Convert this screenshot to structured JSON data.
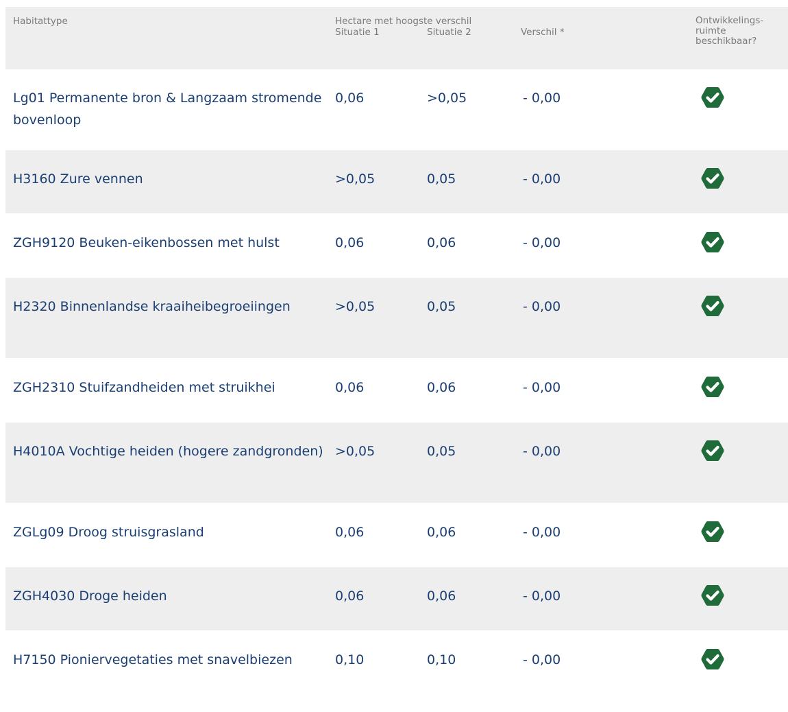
{
  "header": {
    "habitat": "Habitattype",
    "hectare": "Hectare met hoogste verschil",
    "situatie1": "Situatie 1",
    "situatie2": "Situatie 2",
    "verschil": "Verschil *",
    "ruimte": "Ontwikkelings-ruimte beschikbaar?"
  },
  "colors": {
    "header_bg": "#eeeeee",
    "header_text": "#7a7a7a",
    "row_text": "#1b3f73",
    "check_green": "#1f6b3a"
  },
  "check_icon": "check-hexagon-icon",
  "rows": [
    {
      "name": "Lg01 Permanente bron & Langzaam stromende bovenloop",
      "s1": "0,06",
      "s2": ">0,05",
      "diff": "- 0,00",
      "available": true
    },
    {
      "name": "H3160 Zure vennen",
      "s1": ">0,05",
      "s2": "0,05",
      "diff": "- 0,00",
      "available": true
    },
    {
      "name": "ZGH9120 Beuken-eikenbossen met hulst",
      "s1": "0,06",
      "s2": "0,06",
      "diff": "- 0,00",
      "available": true
    },
    {
      "name": "H2320 Binnenlandse kraaiheibegroeiingen",
      "s1": ">0,05",
      "s2": "0,05",
      "diff": "- 0,00",
      "available": true
    },
    {
      "name": "ZGH2310 Stuifzandheiden met struikhei",
      "s1": "0,06",
      "s2": "0,06",
      "diff": "- 0,00",
      "available": true
    },
    {
      "name": "H4010A Vochtige heiden (hogere zandgronden)",
      "s1": ">0,05",
      "s2": "0,05",
      "diff": "- 0,00",
      "available": true
    },
    {
      "name": "ZGLg09 Droog struisgrasland",
      "s1": "0,06",
      "s2": "0,06",
      "diff": "- 0,00",
      "available": true
    },
    {
      "name": "ZGH4030 Droge heiden",
      "s1": "0,06",
      "s2": "0,06",
      "diff": "- 0,00",
      "available": true
    },
    {
      "name": "H7150 Pioniervegetaties met snavelbiezen",
      "s1": "0,10",
      "s2": "0,10",
      "diff": "- 0,00",
      "available": true
    }
  ]
}
